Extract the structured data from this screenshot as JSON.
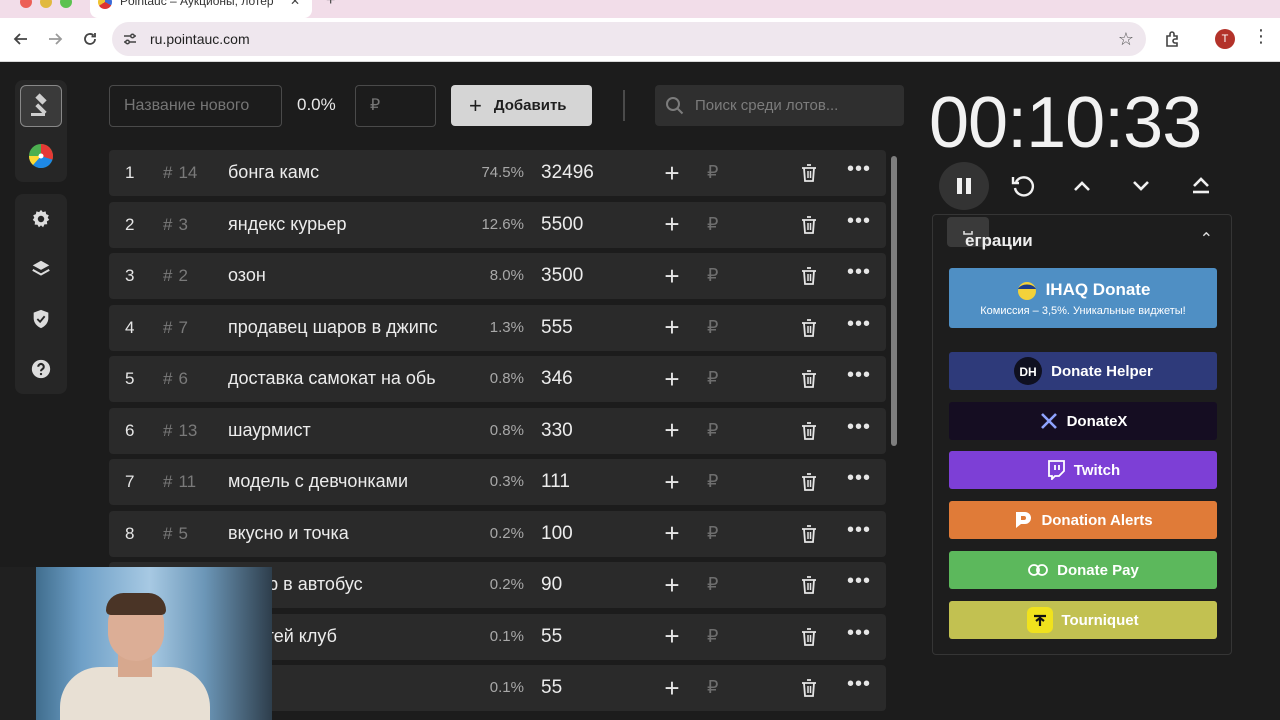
{
  "browser": {
    "tab_title": "Pointauc – Аукционы, лотер",
    "url": "ru.pointauc.com",
    "profile_initial": "T"
  },
  "sidebar": {
    "items": [
      "gavel-icon",
      "wheel-icon",
      "gear-icon",
      "layers-icon",
      "shield-icon",
      "help-icon"
    ]
  },
  "new_lot": {
    "name_placeholder": "Название нового",
    "percent": "0.0%",
    "amount_placeholder": "₽",
    "add_label": "Добавить"
  },
  "search": {
    "placeholder": "Поиск среди лотов..."
  },
  "lots": [
    {
      "index": "1",
      "id": "14",
      "name": "бонга камс",
      "percent": "74.5%",
      "amount": "32496"
    },
    {
      "index": "2",
      "id": "3",
      "name": "яндекс курьер",
      "percent": "12.6%",
      "amount": "5500"
    },
    {
      "index": "3",
      "id": "2",
      "name": "озон",
      "percent": "8.0%",
      "amount": "3500"
    },
    {
      "index": "4",
      "id": "7",
      "name": "продавец шаров в джипс",
      "percent": "1.3%",
      "amount": "555"
    },
    {
      "index": "5",
      "id": "6",
      "name": "доставка самокат на обь",
      "percent": "0.8%",
      "amount": "346"
    },
    {
      "index": "6",
      "id": "13",
      "name": "шаурмист",
      "percent": "0.8%",
      "amount": "330"
    },
    {
      "index": "7",
      "id": "11",
      "name": "модель с девчонками",
      "percent": "0.3%",
      "amount": "111"
    },
    {
      "index": "8",
      "id": "5",
      "name": "вкусно и точка",
      "percent": "0.2%",
      "amount": "100"
    },
    {
      "index": "",
      "id": "",
      "name": "ролер в автобус",
      "percent": "0.2%",
      "amount": "90"
    },
    {
      "index": "",
      "id": "",
      "name": "ин в гей клуб",
      "percent": "0.1%",
      "amount": "55"
    },
    {
      "index": "",
      "id": "",
      "name": "",
      "percent": "0.1%",
      "amount": "55"
    }
  ],
  "lot_currency": "₽",
  "timer": {
    "value": "00:10:33"
  },
  "integrations": {
    "title": "еграции",
    "buttons": [
      {
        "key": "ihaq",
        "label": "IHAQ Donate",
        "sub": "Комиссия – 3,5%. Уникальные виджеты!",
        "color": "#4f8fc4"
      },
      {
        "key": "donate-helper",
        "label": "Donate Helper",
        "color": "#2e3a7a"
      },
      {
        "key": "donatex",
        "label": "DonateX",
        "color": "#150d22"
      },
      {
        "key": "twitch",
        "label": "Twitch",
        "color": "#7d3fd6"
      },
      {
        "key": "donation-alerts",
        "label": "Donation Alerts",
        "color": "#e07b38"
      },
      {
        "key": "donate-pay",
        "label": "Donate Pay",
        "color": "#5cb85c"
      },
      {
        "key": "tourniquet",
        "label": "Tourniquet",
        "color": "#c2c151"
      }
    ]
  },
  "colors": {
    "accent_light": "#d5d5d5",
    "row_bg": "#2a2a2a",
    "app_bg": "#1c1c1c"
  }
}
